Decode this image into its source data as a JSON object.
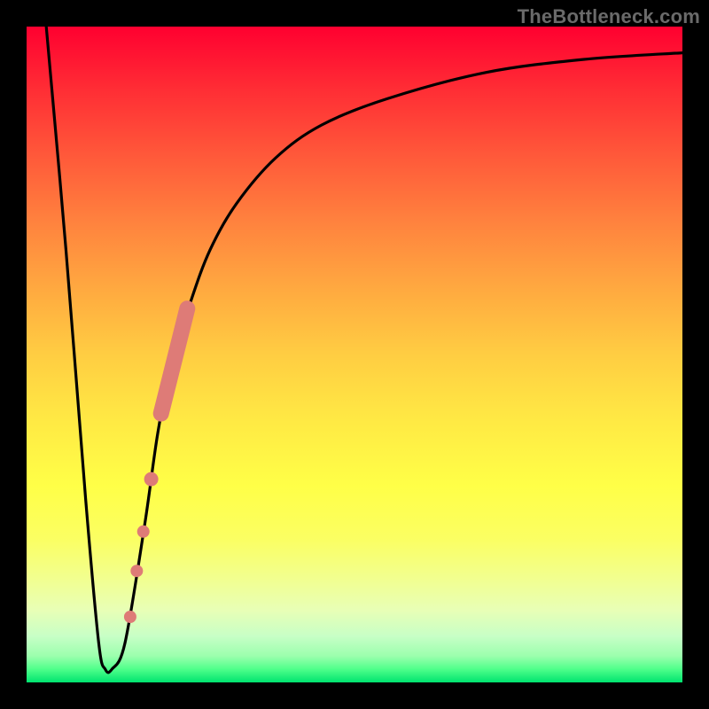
{
  "watermark": "TheBottleneck.com",
  "chart_data": {
    "type": "line",
    "title": "",
    "xlabel": "",
    "ylabel": "",
    "xlim": [
      0,
      100
    ],
    "ylim": [
      0,
      100
    ],
    "grid": false,
    "legend": false,
    "background_gradient": {
      "direction": "vertical",
      "stops": [
        {
          "pos": 0.0,
          "color": "#ff0030"
        },
        {
          "pos": 0.5,
          "color": "#ffcd42"
        },
        {
          "pos": 0.75,
          "color": "#ffff47"
        },
        {
          "pos": 1.0,
          "color": "#00e36f"
        }
      ]
    },
    "series": [
      {
        "name": "bottleneck-curve",
        "color": "#000000",
        "x": [
          3,
          6,
          9,
          11,
          12,
          13,
          15,
          18,
          20,
          22,
          25,
          28,
          32,
          38,
          45,
          55,
          70,
          85,
          100
        ],
        "y": [
          100,
          66,
          28,
          6,
          2,
          2,
          6,
          24,
          38,
          48,
          58,
          66,
          73,
          80,
          85,
          89,
          93,
          95,
          96
        ]
      }
    ],
    "highlighted_segment": {
      "name": "highlight-band",
      "color": "#de7b77",
      "thick_part": {
        "x_range": [
          20.5,
          24.5
        ],
        "y_range": [
          41,
          57
        ]
      },
      "dots": [
        {
          "x": 19.0,
          "y": 31
        },
        {
          "x": 17.8,
          "y": 23
        },
        {
          "x": 16.8,
          "y": 17
        },
        {
          "x": 15.8,
          "y": 10
        }
      ]
    }
  }
}
